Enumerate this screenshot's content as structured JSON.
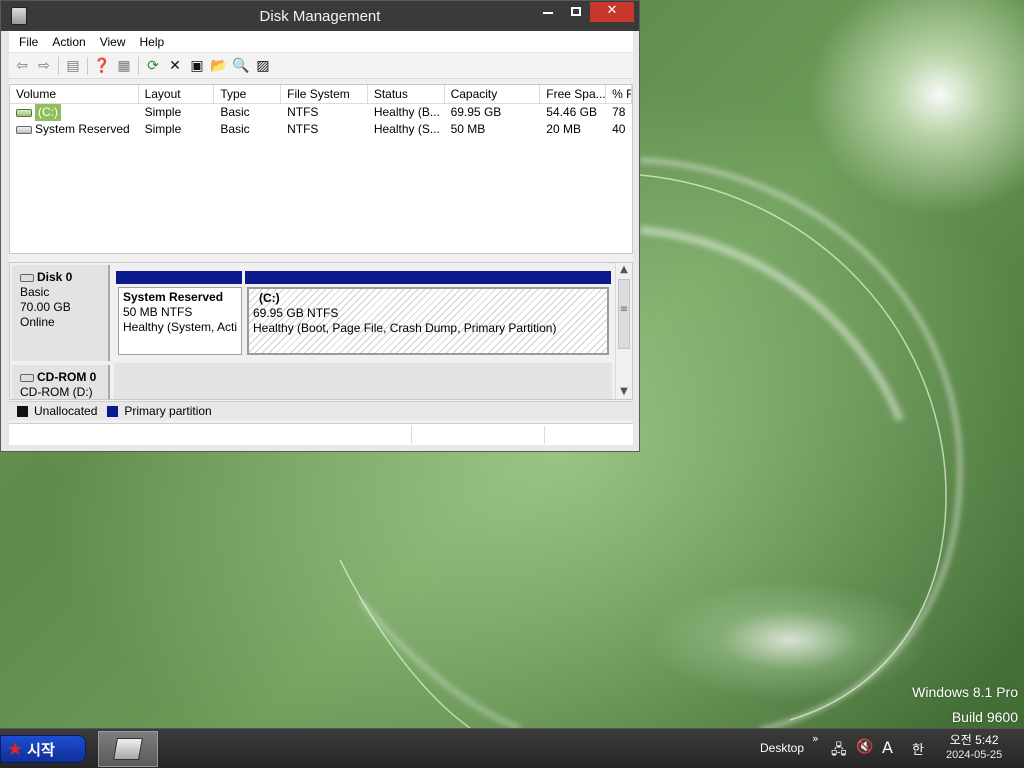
{
  "window": {
    "title": "Disk Management",
    "menu": [
      "File",
      "Action",
      "View",
      "Help"
    ]
  },
  "toolbar": {
    "icons": [
      "back-icon",
      "forward-icon",
      "console-tree-icon",
      "help-icon",
      "show-pane-icon",
      "refresh-icon",
      "delete-icon",
      "properties-icon",
      "open-icon",
      "search-icon",
      "export-icon"
    ]
  },
  "volume_list": {
    "columns": [
      "Volume",
      "Layout",
      "Type",
      "File System",
      "Status",
      "Capacity",
      "Free Spa...",
      "% F"
    ],
    "rows": [
      {
        "volume": "(C:)",
        "layout": "Simple",
        "type": "Basic",
        "fs": "NTFS",
        "status": "Healthy (B...",
        "capacity": "69.95 GB",
        "free": "54.46 GB",
        "pct": "78"
      },
      {
        "volume": "System Reserved",
        "layout": "Simple",
        "type": "Basic",
        "fs": "NTFS",
        "status": "Healthy (S...",
        "capacity": "50 MB",
        "free": "20 MB",
        "pct": "40"
      }
    ]
  },
  "disks": [
    {
      "name": "Disk 0",
      "type": "Basic",
      "size": "70.00 GB",
      "state": "Online",
      "partitions": [
        {
          "name": "System Reserved",
          "size": "50 MB NTFS",
          "status": "Healthy (System, Acti"
        },
        {
          "name": "(C:)",
          "size": "69.95 GB NTFS",
          "status": "Healthy (Boot, Page File, Crash Dump, Primary Partition)"
        }
      ]
    },
    {
      "name": "CD-ROM 0",
      "sub": "CD-ROM (D:)"
    }
  ],
  "legend": {
    "unallocated": "Unallocated",
    "primary": "Primary partition"
  },
  "watermark": {
    "line1": "Windows 8.1 Pro",
    "line2": "Build 9600"
  },
  "taskbar": {
    "start_label": "시작",
    "desktop_label": "Desktop",
    "ime_label": "A",
    "hangul_label": "한",
    "time": "오전 5:42",
    "date": "2024-05-25"
  },
  "colors": {
    "primary_partition": "#0a1a8c",
    "close_button": "#c7372d",
    "selection": "#8fbf5a"
  }
}
